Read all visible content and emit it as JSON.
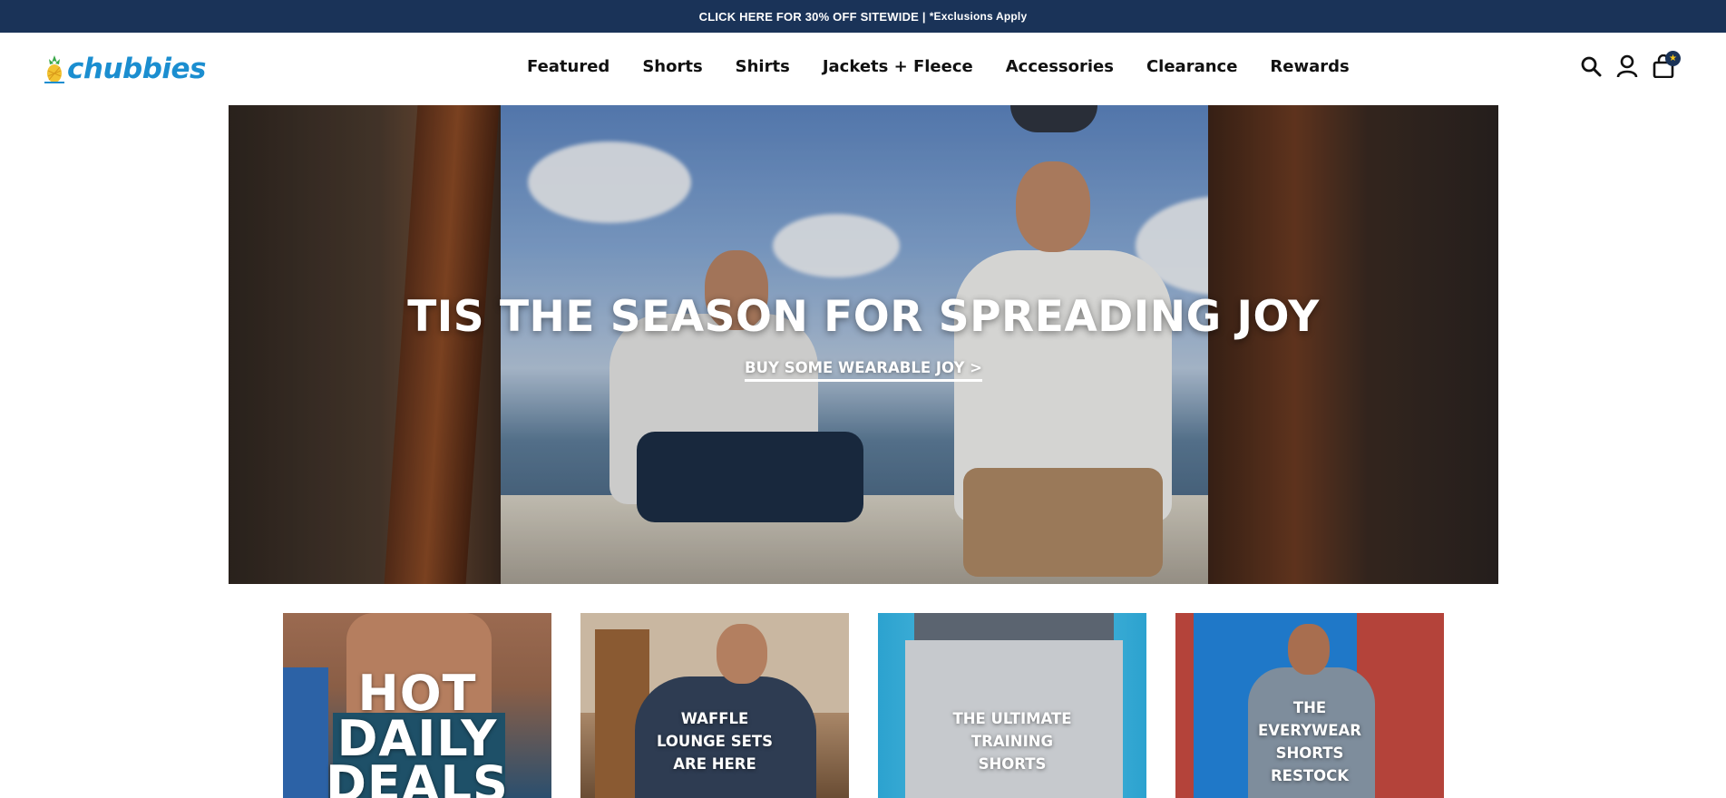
{
  "announcement": {
    "main": "CLICK HERE FOR 30% OFF SITEWIDE |",
    "sub": "*Exclusions Apply"
  },
  "brand": {
    "name": "chubbies",
    "color": "#1b8ed0"
  },
  "nav": {
    "items": [
      "Featured",
      "Shorts",
      "Shirts",
      "Jackets + Fleece",
      "Accessories",
      "Clearance",
      "Rewards"
    ]
  },
  "header_icons": [
    "search-icon",
    "account-icon",
    "cart-icon"
  ],
  "cart": {
    "badge": "★"
  },
  "hero": {
    "title": "TIS THE SEASON FOR SPREADING JOY",
    "cta": "BUY SOME WEARABLE JOY >"
  },
  "tiles": [
    {
      "label_lines": [
        "HOT",
        "DAILY",
        "DEALS"
      ]
    },
    {
      "label_lines": [
        "WAFFLE",
        "LOUNGE SETS",
        "ARE HERE"
      ]
    },
    {
      "label_lines": [
        "THE ULTIMATE",
        "TRAINING",
        "SHORTS"
      ]
    },
    {
      "label_lines": [
        "THE",
        "EVERYWEAR",
        "SHORTS",
        "RESTOCK"
      ]
    }
  ],
  "colors": {
    "announcement_bg": "#1a3358",
    "text": "#111111"
  }
}
